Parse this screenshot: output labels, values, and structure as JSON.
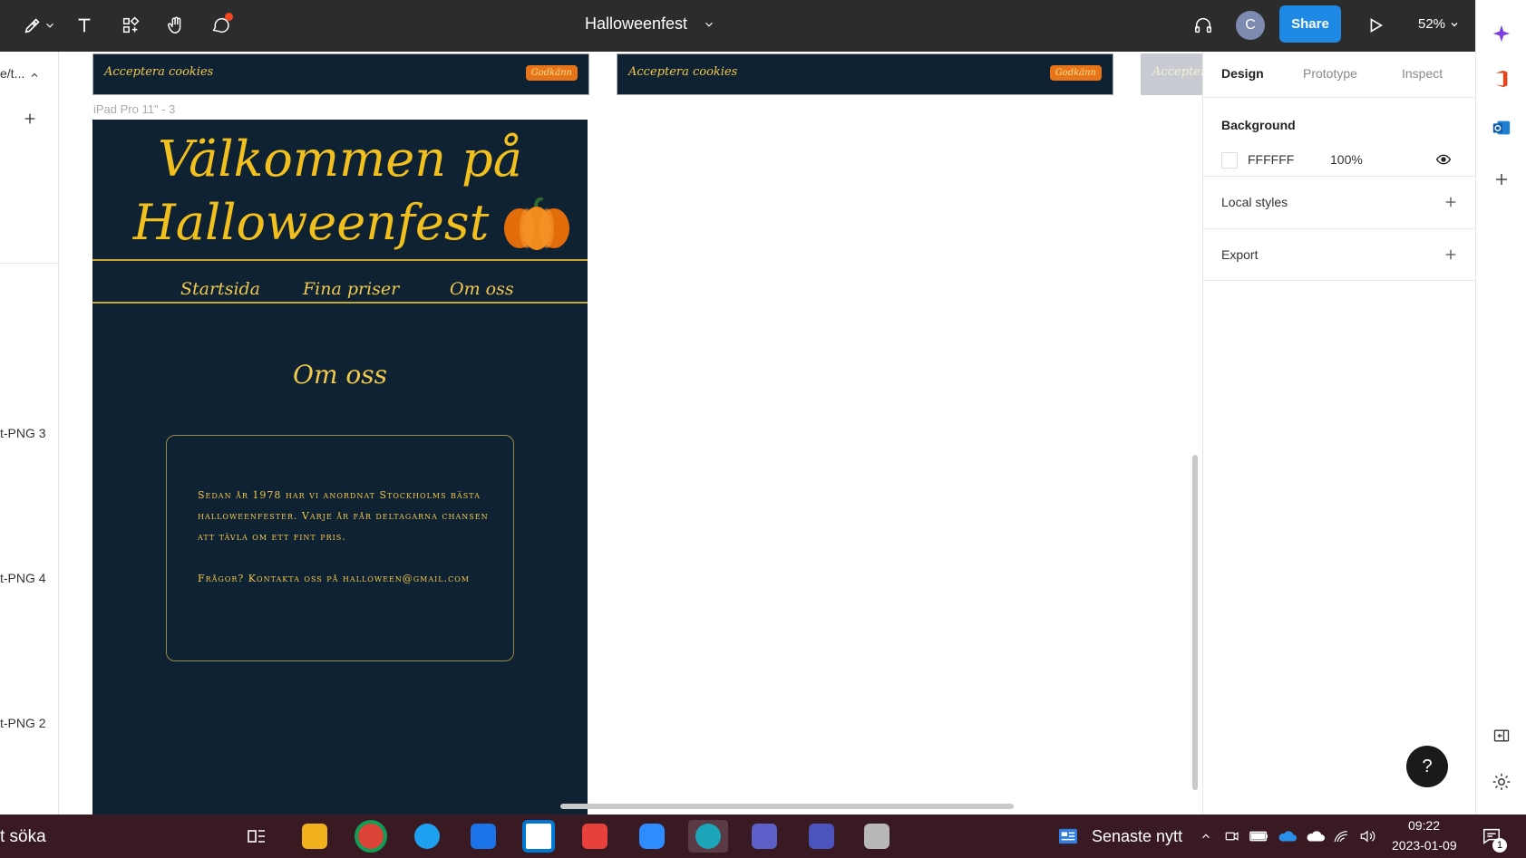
{
  "topbar": {
    "file_title": "Halloweenfest",
    "share_label": "Share",
    "avatar_initial": "C",
    "zoom_level": "52%",
    "tools": [
      "move-tool-icon",
      "pen-tool-icon",
      "text-tool-icon",
      "components-icon",
      "hand-tool-icon",
      "comment-icon"
    ]
  },
  "left_panel": {
    "path_fragment": "e/t...",
    "items": [
      "t-PNG 3",
      "t-PNG 4",
      "t-PNG 2"
    ]
  },
  "canvas": {
    "cookie_banners": [
      {
        "text": "Acceptera cookies",
        "button": "Godkänn"
      },
      {
        "text": "Acceptera cookies",
        "button": "Godkänn"
      },
      {
        "text": "Acceptera"
      }
    ],
    "frame_label": "iPad Pro 11\" - 3",
    "hero_line1": "Välkommen på",
    "hero_line2": "Halloweenfest",
    "nav": [
      "Startsida",
      "Fina priser",
      "Om oss"
    ],
    "section_title": "Om oss",
    "info_paragraph1": "Sedan år 1978 har vi anordnat Stockholms bästa halloweenfester. Varje år får deltagarna chansen att tävla om ett fint pris.",
    "info_paragraph2": "Frågor? Kontakta oss på halloween@gmail.com"
  },
  "right_panel": {
    "tabs": [
      "Design",
      "Prototype",
      "Inspect"
    ],
    "active_tab": "Design",
    "background_label": "Background",
    "background_hex": "FFFFFF",
    "background_opacity": "100%",
    "local_styles_label": "Local styles",
    "export_label": "Export"
  },
  "help_button": "?",
  "taskbar": {
    "search_text": "t söka",
    "news_label": "Senaste nytt",
    "time": "09:22",
    "date": "2023-01-09",
    "notification_count": "1"
  },
  "colors": {
    "frame_bg": "#0f2233",
    "gold": "#f2c01e",
    "orange": "#e8741a",
    "share_blue": "#1e88e5",
    "taskbar": "#3a1a22"
  }
}
